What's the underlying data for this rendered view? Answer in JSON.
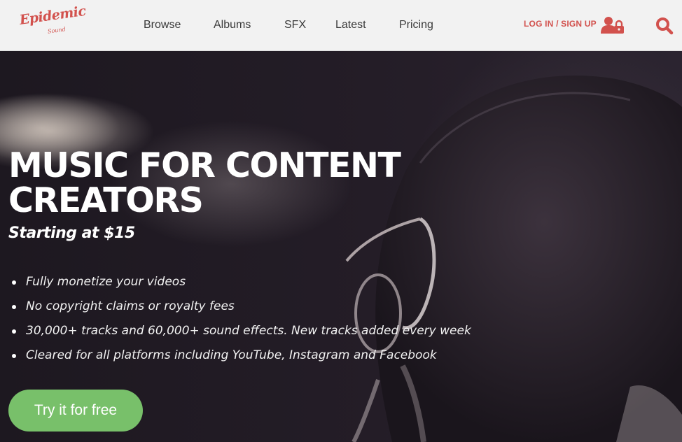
{
  "brand": {
    "logo_text": "Epidemic",
    "logo_subtext": "Sound",
    "accent_color": "#d2514d",
    "cta_color": "#78c06a"
  },
  "nav": {
    "items": [
      {
        "label": "Browse"
      },
      {
        "label": "Albums"
      },
      {
        "label": "SFX"
      },
      {
        "label": "Latest"
      },
      {
        "label": "Pricing"
      }
    ],
    "login_label": "LOG IN / SIGN UP",
    "icons": {
      "user": "user-lock-icon",
      "search": "search-icon"
    }
  },
  "hero": {
    "headline_line1": "MUSIC FOR CONTENT",
    "headline_line2": "CREATORS",
    "subhead": "Starting at $15",
    "features": [
      "Fully monetize your videos",
      "No copyright claims or royalty fees",
      "30,000+ tracks and 60,000+ sound effects. New tracks added every week",
      "Cleared for all platforms including YouTube, Instagram and Facebook"
    ],
    "cta_label": "Try it for free"
  }
}
